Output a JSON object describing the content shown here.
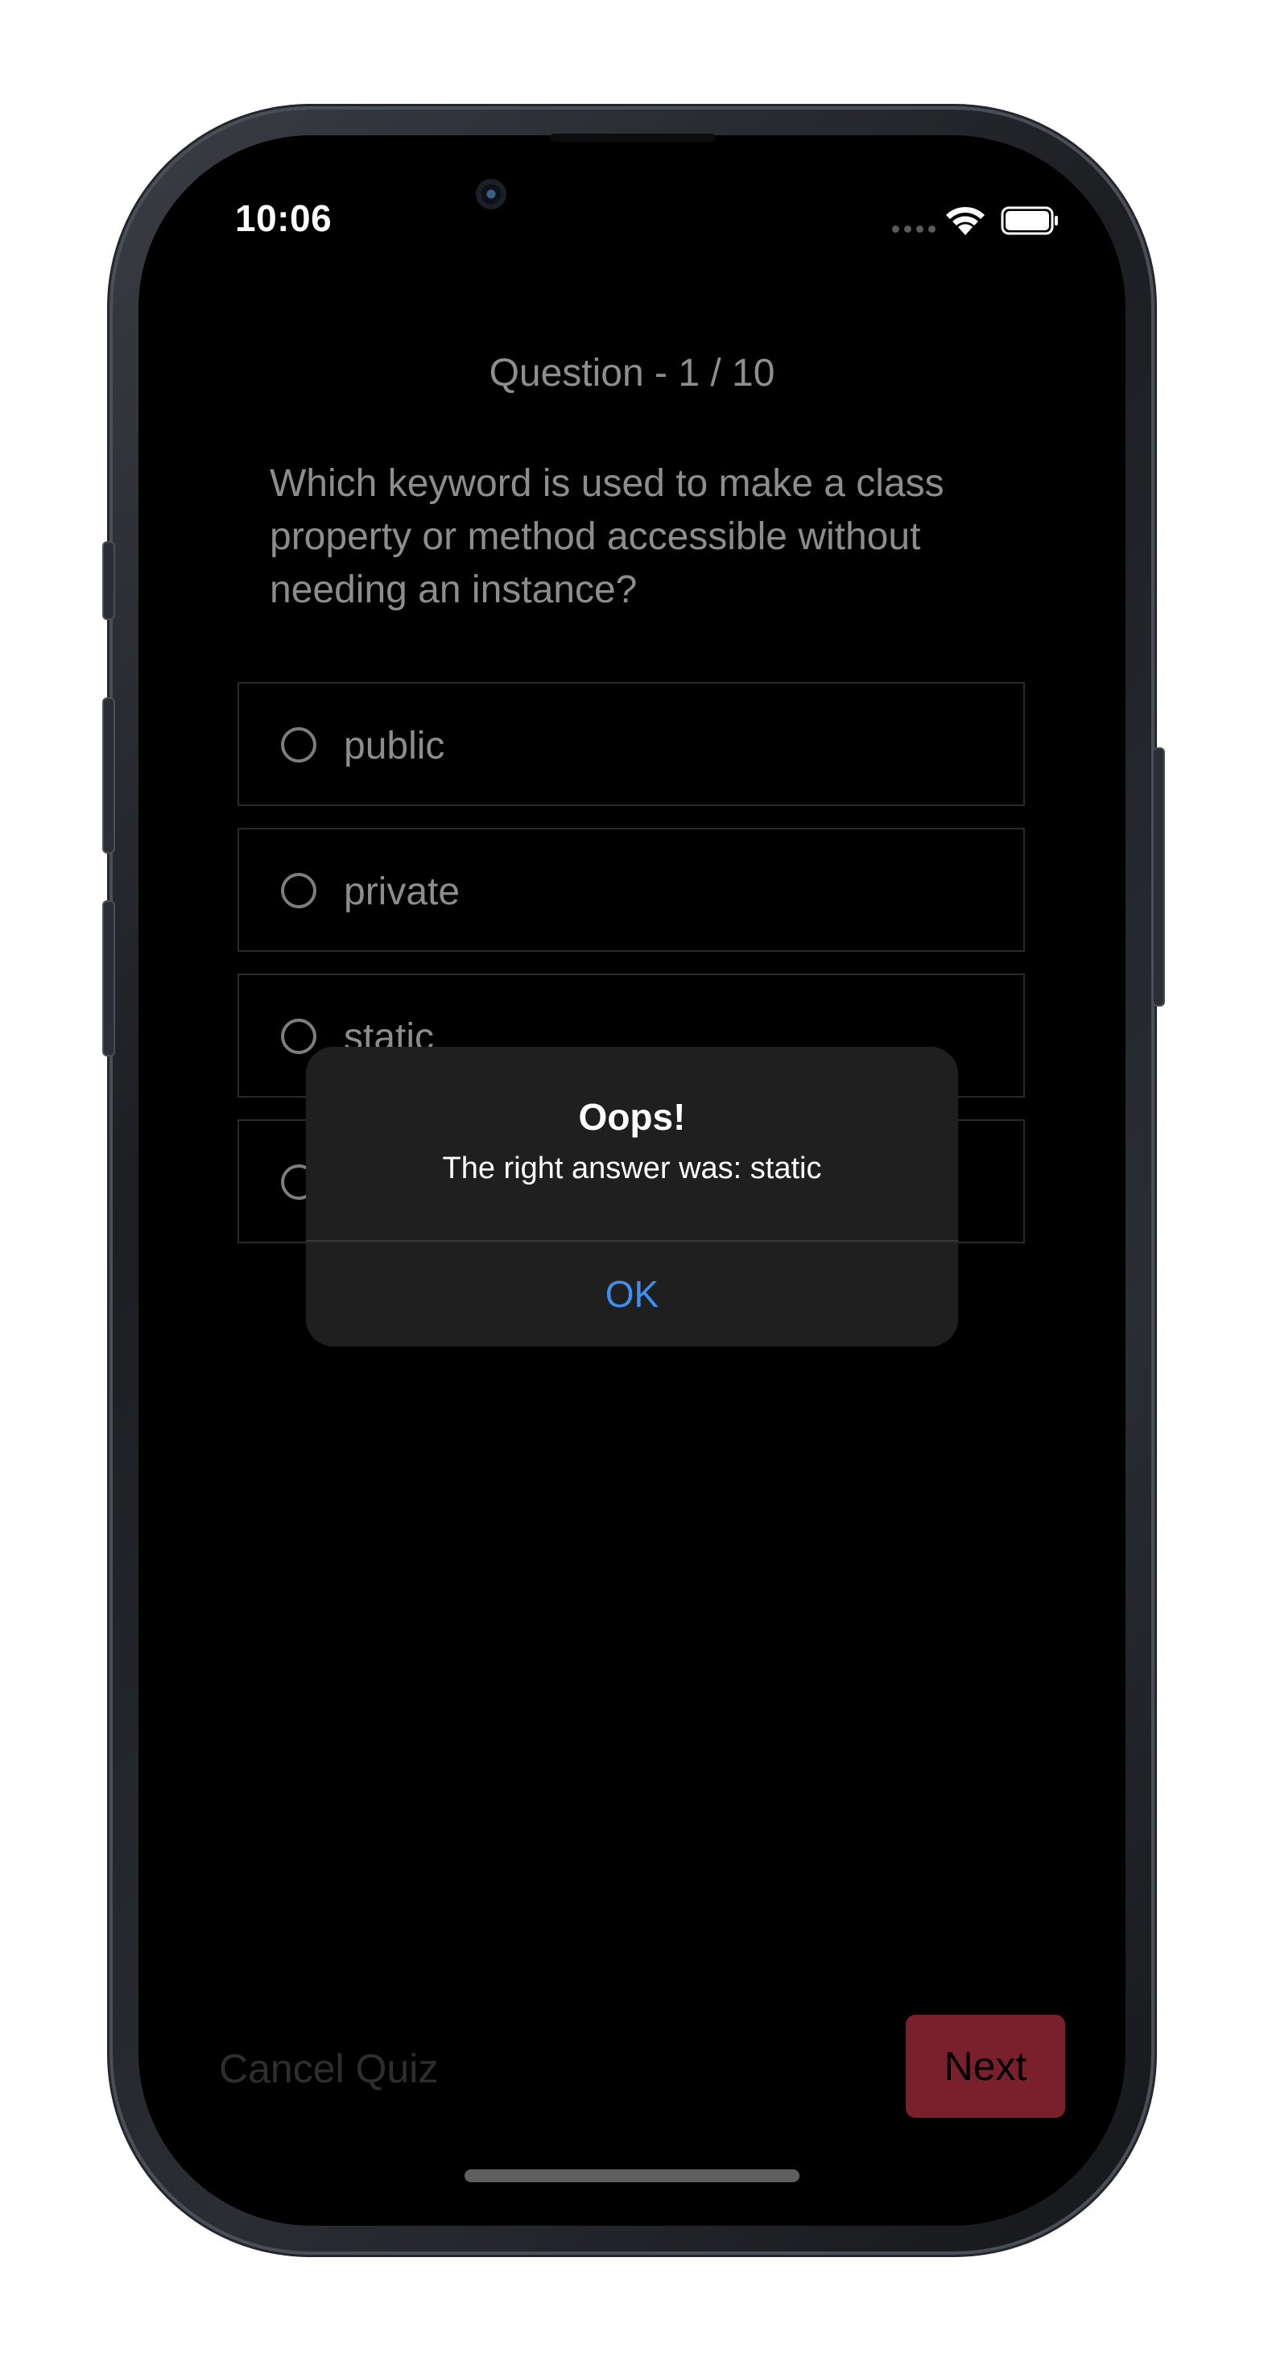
{
  "status_bar": {
    "time": "10:06"
  },
  "quiz": {
    "counter": "Question - 1 / 10",
    "question": "Which keyword is used to make a class property or method accessible without needing an instance?",
    "options": [
      {
        "label": "public"
      },
      {
        "label": "private"
      },
      {
        "label": "static"
      },
      {
        "label": ""
      }
    ]
  },
  "alert": {
    "title": "Oops!",
    "message": "The right answer was: static",
    "ok_label": "OK"
  },
  "footer": {
    "cancel_label": "Cancel Quiz",
    "next_label": "Next"
  },
  "colors": {
    "accent_ok": "#3d8ff0",
    "next_button": "#7a1f2c",
    "background": "#000000"
  }
}
